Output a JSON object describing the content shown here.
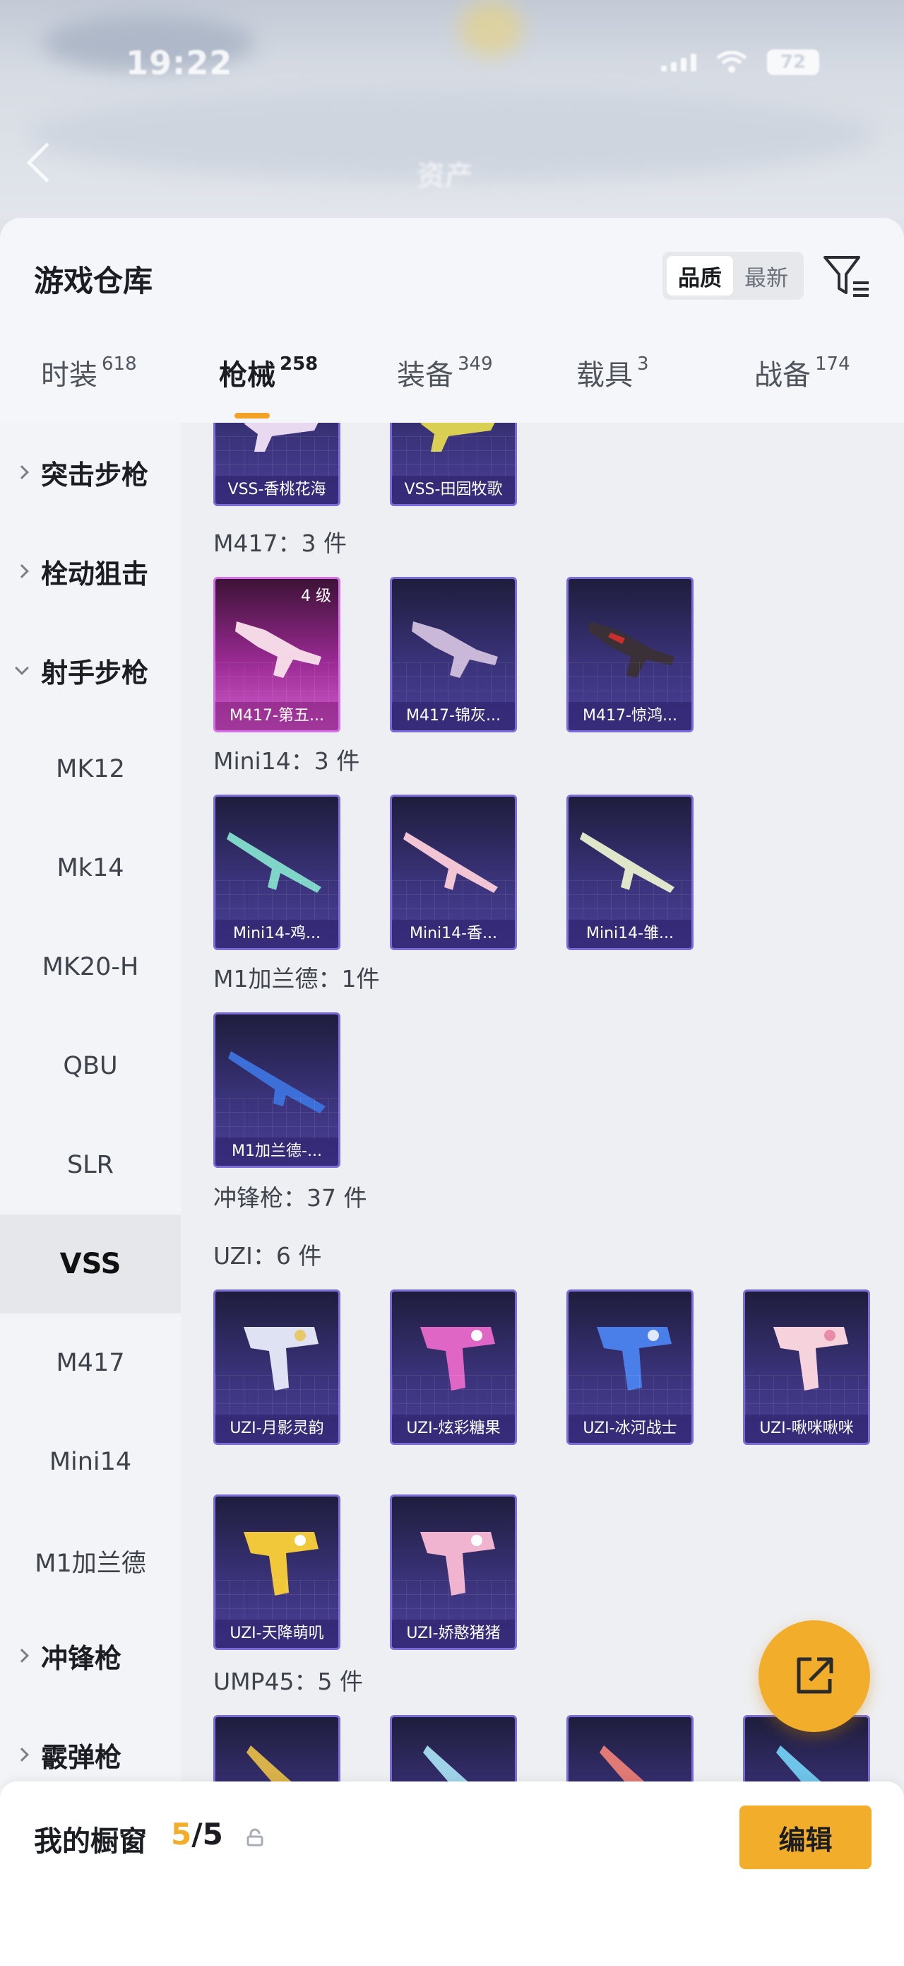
{
  "status": {
    "time": "19:22",
    "battery": "72"
  },
  "background": {
    "title": "资产"
  },
  "header": {
    "title": "游戏仓库",
    "sort_quality": "品质",
    "sort_latest": "最新"
  },
  "tabs": [
    {
      "label": "时装",
      "count": "618"
    },
    {
      "label": "枪械",
      "count": "258"
    },
    {
      "label": "装备",
      "count": "349"
    },
    {
      "label": "载具",
      "count": "3"
    },
    {
      "label": "战备",
      "count": "174"
    }
  ],
  "sidenav": {
    "categories": [
      "突击步枪",
      "栓动狙击",
      "射手步枪",
      "冲锋枪",
      "霰弹枪"
    ],
    "subitems": [
      "MK12",
      "Mk14",
      "MK20-H",
      "QBU",
      "SLR",
      "VSS",
      "M417",
      "Mini14",
      "M1加兰德"
    ]
  },
  "content": {
    "sections": {
      "m417": "M417：3 件",
      "mini14": "Mini14：3 件",
      "m1": "M1加兰德：1件",
      "smg": "冲锋枪：37 件",
      "uzi": "UZI：6 件",
      "ump45": "UMP45：5 件"
    },
    "vss_cards": [
      "VSS-香桃花海",
      "VSS-田园牧歌"
    ],
    "m417_cards": [
      "M417-第五...",
      "M417-锦灰...",
      "M417-惊鸿..."
    ],
    "m417_level": "4 级",
    "mini14_cards": [
      "Mini14-鸡...",
      "Mini14-香...",
      "Mini14-雏..."
    ],
    "m1_cards": [
      "M1加兰德-..."
    ],
    "uzi_cards": [
      "UZI-月影灵韵",
      "UZI-炫彩糖果",
      "UZI-冰河战士",
      "UZI-啾咪啾咪",
      "UZI-天降萌叽",
      "UZI-娇憨猪猪"
    ]
  },
  "bottom": {
    "label": "我的橱窗",
    "count_current": "5",
    "count_sep": "/5",
    "edit": "编辑"
  },
  "colors": {
    "accent": "#f2ad2a",
    "card_purple": "#3a337a",
    "card_pink": "#d35fd0"
  }
}
